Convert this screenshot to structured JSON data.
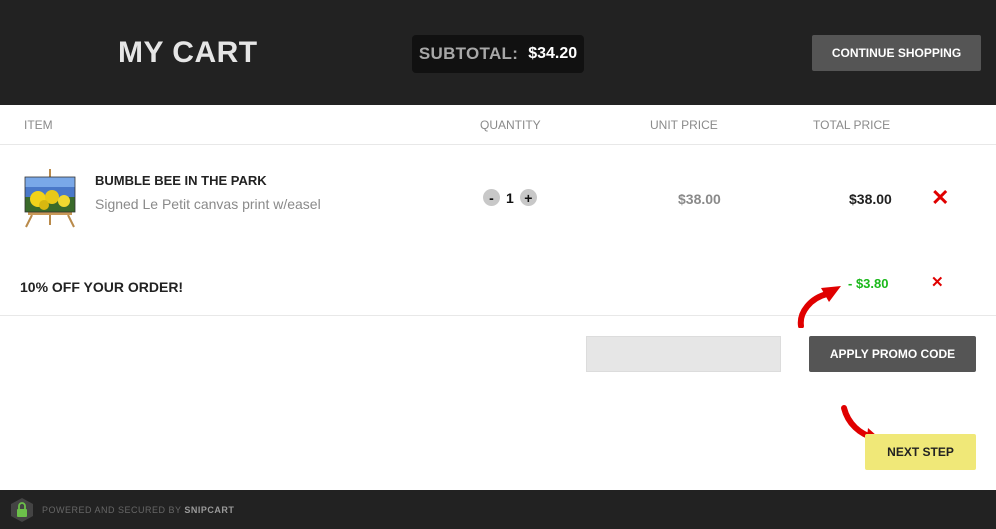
{
  "header": {
    "title": "MY CART",
    "subtotal_label": "SUBTOTAL:",
    "subtotal_value": "$34.20",
    "continue_label": "CONTINUE SHOPPING"
  },
  "columns": {
    "item": "ITEM",
    "quantity": "QUANTITY",
    "unit_price": "UNIT PRICE",
    "total_price": "TOTAL PRICE"
  },
  "item": {
    "name": "BUMBLE BEE IN THE PARK",
    "description": "Signed Le Petit canvas print w/easel",
    "minus": "-",
    "quantity": "1",
    "plus": "+",
    "unit_price": "$38.00",
    "total_price": "$38.00",
    "remove": "✕"
  },
  "discount": {
    "label": "10% OFF YOUR ORDER!",
    "amount": "- $3.80",
    "remove": "✕"
  },
  "promo": {
    "placeholder": "",
    "apply_label": "APPLY PROMO CODE"
  },
  "next_step_label": "NEXT STEP",
  "footer": {
    "powered_text": "POWERED AND SECURED BY",
    "brand": "SNIPCART"
  },
  "colors": {
    "header_bg": "#222222",
    "button_dark": "#555555",
    "next_button": "#f0e878",
    "remove_red": "#e00000",
    "discount_green": "#1ab81a",
    "annotation_arrow": "#e00000"
  },
  "icons": {
    "remove": "close-icon",
    "lock": "lock-icon",
    "arrow": "annotation-arrow-icon"
  }
}
